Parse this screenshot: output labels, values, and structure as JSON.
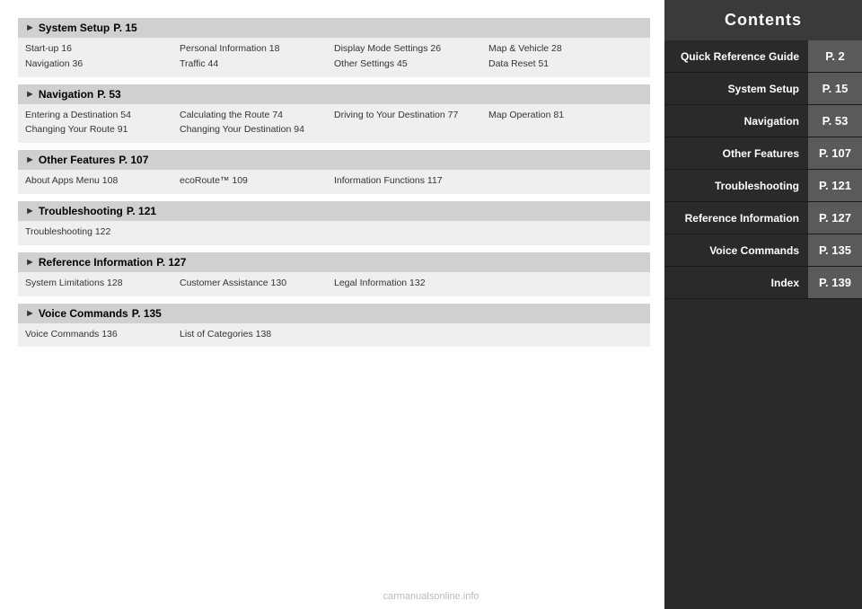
{
  "sidebar": {
    "title": "Contents",
    "items": [
      {
        "label": "Quick Reference Guide",
        "page": "P. 2"
      },
      {
        "label": "System Setup",
        "page": "P. 15"
      },
      {
        "label": "Navigation",
        "page": "P. 53"
      },
      {
        "label": "Other Features",
        "page": "P. 107"
      },
      {
        "label": "Troubleshooting",
        "page": "P. 121"
      },
      {
        "label": "Reference Information",
        "page": "P. 127"
      },
      {
        "label": "Voice Commands",
        "page": "P. 135"
      },
      {
        "label": "Index",
        "page": "P. 139"
      }
    ]
  },
  "sections": [
    {
      "title": "System Setup",
      "page": "P. 15",
      "rows": [
        [
          "Start-up 16",
          "Personal Information 18",
          "Display Mode Settings 26",
          "Map & Vehicle 28"
        ],
        [
          "Navigation 36",
          "Traffic 44",
          "Other Settings 45",
          "Data Reset 51"
        ]
      ]
    },
    {
      "title": "Navigation",
      "page": "P. 53",
      "rows": [
        [
          "Entering a Destination 54",
          "Calculating the Route 74",
          "Driving to Your Destination 77",
          "Map Operation 81"
        ],
        [
          "Changing Your Route 91",
          "Changing Your Destination 94",
          "",
          ""
        ]
      ]
    },
    {
      "title": "Other Features",
      "page": "P. 107",
      "rows": [
        [
          "About Apps Menu 108",
          "ecoRoute™ 109",
          "Information Functions 117",
          ""
        ]
      ]
    },
    {
      "title": "Troubleshooting",
      "page": "P. 121",
      "rows": [
        [
          "Troubleshooting 122",
          "",
          "",
          ""
        ]
      ]
    },
    {
      "title": "Reference Information",
      "page": "P. 127",
      "rows": [
        [
          "System Limitations 128",
          "Customer Assistance 130",
          "Legal Information 132",
          ""
        ]
      ]
    },
    {
      "title": "Voice Commands",
      "page": "P. 135",
      "rows": [
        [
          "Voice Commands 136",
          "List of Categories 138",
          "",
          ""
        ]
      ]
    }
  ],
  "watermark": "carmanualsonline.info"
}
